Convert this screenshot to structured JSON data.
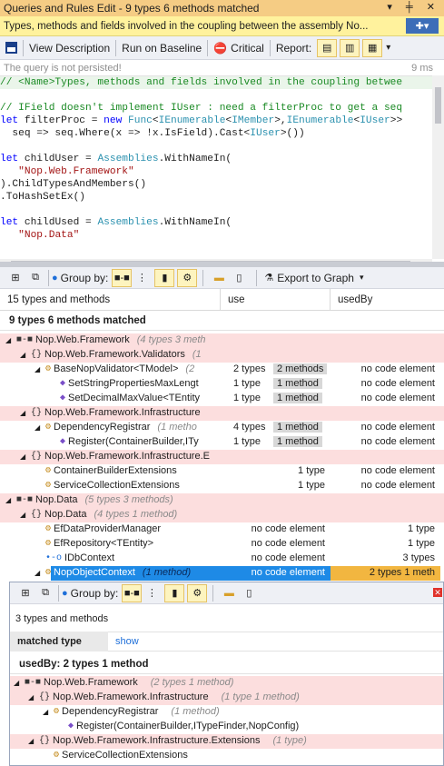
{
  "titlebar": {
    "title": "Queries and Rules Edit  - 9 types   6 methods   matched",
    "controls": "▾ ╪ ✕"
  },
  "querybar": {
    "text": "Types, methods and fields involved in the coupling between  the assembly No..."
  },
  "toolbar": {
    "view_description": "View Description",
    "run_on_baseline": "Run on Baseline",
    "critical": "Critical",
    "report": "Report:"
  },
  "notice": {
    "message": "The query is not persisted!",
    "time": "9 ms"
  },
  "editor": {
    "lines": [
      "// <Name>Types, methods and fields involved in the coupling betwee",
      "",
      "// IField doesn't implement IUser : need a filterProc to get a seq",
      "let filterProc = new Func<IEnumerable<IMember>,IEnumerable<IUser>>",
      "  seq => seq.Where(x => !x.IsField).Cast<IUser>())",
      "",
      "let childUser = Assemblies.WithNameIn(",
      "   \"Nop.Web.Framework\"",
      ").ChildTypesAndMembers()",
      ".ToHashSetEx()",
      "",
      "let childUsed = Assemblies.WithNameIn(",
      "   \"Nop.Data\""
    ]
  },
  "results_toolbar": {
    "group_by": "Group by:",
    "export_to_graph": "Export to Graph"
  },
  "grid": {
    "col_name": "15 types and methods",
    "col_use": "use",
    "col_usedby": "usedBy",
    "matched_label": "9 types   6 methods   matched",
    "rows": [
      {
        "indent": 0,
        "expand": "◢",
        "ico": "■-■",
        "name": "Nop.Web.Framework",
        "extra": "(4 types    3 meth",
        "pink": true,
        "use": "",
        "usedby": ""
      },
      {
        "indent": 1,
        "expand": "◢",
        "ico": "{}",
        "name": "Nop.Web.Framework.Validators",
        "extra": "(1",
        "pink": true,
        "use": "",
        "usedby": ""
      },
      {
        "indent": 2,
        "expand": "◢",
        "ico": "⚙",
        "name": "BaseNopValidator<TModel>",
        "extra": "(2",
        "pink": false,
        "use": "2 types   2 methods",
        "usedby": "no code element"
      },
      {
        "indent": 3,
        "expand": "",
        "ico": "◆",
        "name": "SetStringPropertiesMaxLengt",
        "extra": "",
        "pink": false,
        "use": "1 type    1 method",
        "usedby": "no code element"
      },
      {
        "indent": 3,
        "expand": "",
        "ico": "◆",
        "name": "SetDecimalMaxValue<TEntity",
        "extra": "",
        "pink": false,
        "use": "1 type    1 method",
        "usedby": "no code element"
      },
      {
        "indent": 1,
        "expand": "◢",
        "ico": "{}",
        "name": "Nop.Web.Framework.Infrastructure",
        "extra": "",
        "pink": true,
        "use": "",
        "usedby": ""
      },
      {
        "indent": 2,
        "expand": "◢",
        "ico": "⚙",
        "name": "DependencyRegistrar",
        "extra": "(1 metho",
        "pink": false,
        "use": "4 types   1 method",
        "usedby": "no code element"
      },
      {
        "indent": 3,
        "expand": "",
        "ico": "◆",
        "name": "Register(ContainerBuilder,ITy",
        "extra": "",
        "pink": false,
        "use": "1 type    1 method",
        "usedby": "no code element"
      },
      {
        "indent": 1,
        "expand": "◢",
        "ico": "{}",
        "name": "Nop.Web.Framework.Infrastructure.E",
        "extra": "",
        "pink": true,
        "use": "",
        "usedby": ""
      },
      {
        "indent": 2,
        "expand": "",
        "ico": "⚙",
        "name": "ContainerBuilderExtensions",
        "extra": "",
        "pink": false,
        "use": "1 type",
        "usedby": "no code element"
      },
      {
        "indent": 2,
        "expand": "",
        "ico": "⚙",
        "name": "ServiceCollectionExtensions",
        "extra": "",
        "pink": false,
        "use": "1 type",
        "usedby": "no code element"
      },
      {
        "indent": 0,
        "expand": "◢",
        "ico": "■-■",
        "name": "Nop.Data",
        "extra": "(5 types    3 methods)",
        "pink": true,
        "use": "",
        "usedby": ""
      },
      {
        "indent": 1,
        "expand": "◢",
        "ico": "{}",
        "name": "Nop.Data",
        "extra": "(4 types    1 method)",
        "pink": true,
        "use": "",
        "usedby": ""
      },
      {
        "indent": 2,
        "expand": "",
        "ico": "⚙",
        "name": "EfDataProviderManager",
        "extra": "",
        "pink": false,
        "use": "no code element",
        "usedby": "1 type"
      },
      {
        "indent": 2,
        "expand": "",
        "ico": "⚙",
        "name": "EfRepository<TEntity>",
        "extra": "",
        "pink": false,
        "use": "no code element",
        "usedby": "1 type"
      },
      {
        "indent": 2,
        "expand": "",
        "ico": "•-o",
        "name": "IDbContext",
        "extra": "",
        "pink": false,
        "use": "no code element",
        "usedby": "3 types"
      },
      {
        "indent": 2,
        "expand": "◢",
        "ico": "⚙",
        "name": "NopObjectContext",
        "extra": "(1 method)",
        "pink": false,
        "selected": true,
        "use": "no code element",
        "usedby": "2 types    1 meth"
      }
    ]
  },
  "subpanel": {
    "group_by": "Group by:",
    "count": "3 types and methods",
    "col_matched": "matched type",
    "col_show": "show",
    "usedby_label": "usedBy: 2 types   1 method",
    "rows": [
      {
        "indent": 0,
        "expand": "◢",
        "ico": "■-■",
        "name": "Nop.Web.Framework",
        "extra": "(2 types    1 method)",
        "pink": true
      },
      {
        "indent": 1,
        "expand": "◢",
        "ico": "{}",
        "name": "Nop.Web.Framework.Infrastructure",
        "extra": "(1 type    1 method)",
        "pink": true
      },
      {
        "indent": 2,
        "expand": "◢",
        "ico": "⚙",
        "name": "DependencyRegistrar",
        "extra": "(1 method)",
        "pink": false
      },
      {
        "indent": 3,
        "expand": "",
        "ico": "◆",
        "name": "Register(ContainerBuilder,ITypeFinder,NopConfig)",
        "extra": "",
        "pink": false
      },
      {
        "indent": 1,
        "expand": "◢",
        "ico": "{}",
        "name": "Nop.Web.Framework.Infrastructure.Extensions",
        "extra": "(1 type)",
        "pink": true
      },
      {
        "indent": 2,
        "expand": "",
        "ico": "⚙",
        "name": "ServiceCollectionExtensions",
        "extra": "",
        "pink": false
      }
    ]
  },
  "colors": {
    "accent": "#f5cc84",
    "query": "#fff29d",
    "pink": "#fcdede",
    "selected": "#1e8ae6"
  }
}
